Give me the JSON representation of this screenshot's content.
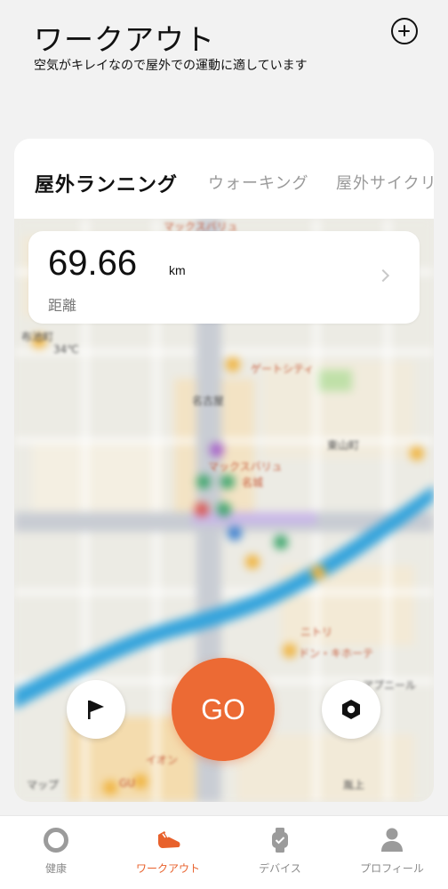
{
  "header": {
    "title": "ワークアウト",
    "subtitle": "空気がキレイなので屋外での運動に適しています",
    "add_icon": "plus-circle-icon"
  },
  "tabs": [
    {
      "label": "屋外ランニング",
      "active": true
    },
    {
      "label": "ウォーキング",
      "active": false
    },
    {
      "label": "屋外サイクリ",
      "active": false
    }
  ],
  "goal": {
    "value": "69.66",
    "unit": "km",
    "label": "距離"
  },
  "map_labels": [
    "マックスバリュ",
    "34℃",
    "布池町",
    "マックスバリュ",
    "ゲートシティ",
    "名古屋",
    "名城",
    "ドン・キホーテ",
    "ニトリ",
    "イオン",
    "GU",
    "アプニール",
    "胤上",
    "東山町",
    "マップ"
  ],
  "controls": {
    "go_label": "GO",
    "flag_icon": "flag-icon",
    "settings_icon": "hex-nut-icon"
  },
  "bottom_nav": [
    {
      "label": "健康",
      "icon": "ring-icon",
      "active": false
    },
    {
      "label": "ワークアウト",
      "icon": "running-shoe-icon",
      "active": true
    },
    {
      "label": "デバイス",
      "icon": "watch-icon",
      "active": false
    },
    {
      "label": "プロフィール",
      "icon": "person-icon",
      "active": false
    }
  ],
  "colors": {
    "accent": "#ec6a34",
    "nav_active": "#e8612c",
    "background": "#f2f2f2"
  }
}
